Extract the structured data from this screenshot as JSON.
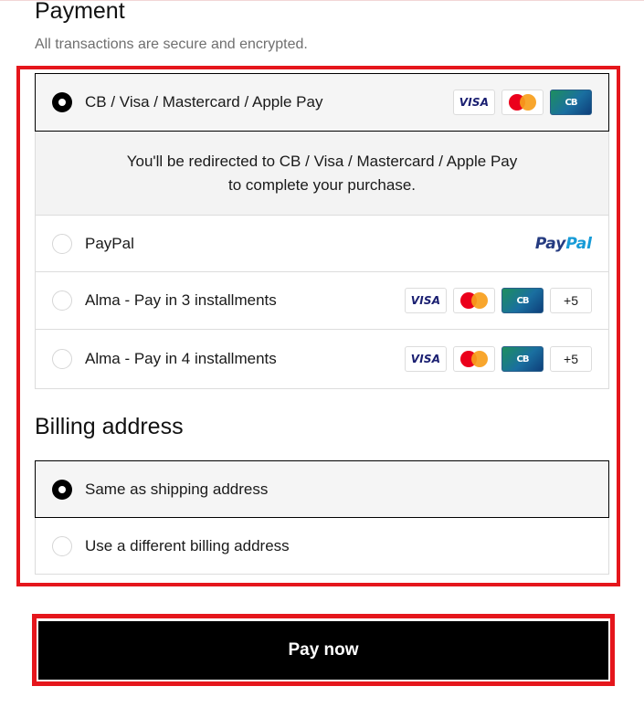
{
  "payment": {
    "title": "Payment",
    "subtitle": "All transactions are secure and encrypted.",
    "options": [
      {
        "label": "CB / Visa / Mastercard / Apple Pay",
        "selected": true,
        "icons": [
          "visa-icon",
          "mastercard-icon",
          "cb-icon"
        ]
      },
      {
        "label": "PayPal",
        "selected": false,
        "icons": [
          "paypal-logo"
        ]
      },
      {
        "label": "Alma - Pay in 3 installments",
        "selected": false,
        "icons": [
          "visa-icon",
          "mastercard-icon",
          "cb-icon"
        ],
        "more": "+5"
      },
      {
        "label": "Alma - Pay in 4 installments",
        "selected": false,
        "icons": [
          "visa-icon",
          "mastercard-icon",
          "cb-icon"
        ],
        "more": "+5"
      }
    ],
    "redirect_text": "You'll be redirected to CB / Visa / Mastercard / Apple Pay to complete your purchase."
  },
  "logos": {
    "visa": "VISA",
    "cb": "CB",
    "paypal_part1": "Pay",
    "paypal_part2": "Pal"
  },
  "billing": {
    "title": "Billing address",
    "options": [
      {
        "label": "Same as shipping address",
        "selected": true
      },
      {
        "label": "Use a different billing address",
        "selected": false
      }
    ]
  },
  "pay_button": {
    "label": "Pay now"
  },
  "colors": {
    "highlight": "#e5161c",
    "button_bg": "#000000",
    "selected_bg": "#f5f5f5",
    "visa_blue": "#1a1f71",
    "paypal_dark": "#253b80",
    "paypal_light": "#179bd7"
  }
}
